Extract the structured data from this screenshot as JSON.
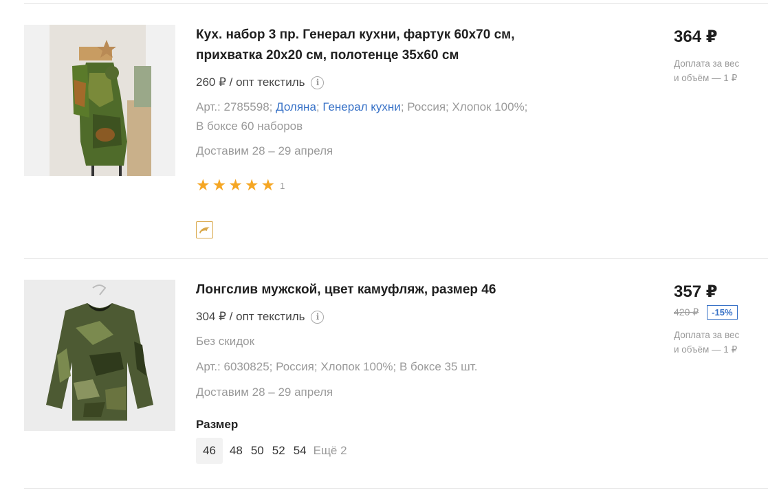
{
  "products": [
    {
      "title": "Кух. набор 3 пр. Генерал кухни, фартук 60х70 см, прихватка 20х20 см, полотенце 35х60 см",
      "price_per_unit": "260 ₽ / опт текстиль",
      "info_symbol": "i",
      "art_prefix": "Арт.: 2785598;",
      "brand_link": "Доляна",
      "series_link": "Генерал кухни",
      "art_suffix": "Россия; Хлопок 100%;",
      "box": "В боксе 60 наборов",
      "delivery": "Доставим 28 – 29 апреля",
      "rating": 5,
      "rating_count": "1",
      "price": "364 ₽",
      "fee_line1": "Доплата за вес",
      "fee_line2": "и объём — 1 ₽"
    },
    {
      "title": "Лонгслив мужской, цвет камуфляж, размер 46",
      "price_per_unit": "304 ₽ / опт текстиль",
      "info_symbol": "i",
      "no_discount": "Без скидок",
      "art": "Арт.: 6030825; Россия; Хлопок 100%; В боксе 35 шт.",
      "delivery": "Доставим 28 – 29 апреля",
      "size_label": "Размер",
      "sizes": [
        "46",
        "48",
        "50",
        "52",
        "54"
      ],
      "selected_size": "46",
      "more_sizes": "Ещё 2",
      "price": "357 ₽",
      "old_price": "420 ₽",
      "discount": "-15%",
      "fee_line1": "Доплата за вес",
      "fee_line2": "и объём — 1 ₽"
    }
  ],
  "colors": {
    "accent_link": "#3872c7",
    "star": "#f5a623",
    "muted": "#9a9a9a",
    "promo_badge": "#d9a84a"
  }
}
